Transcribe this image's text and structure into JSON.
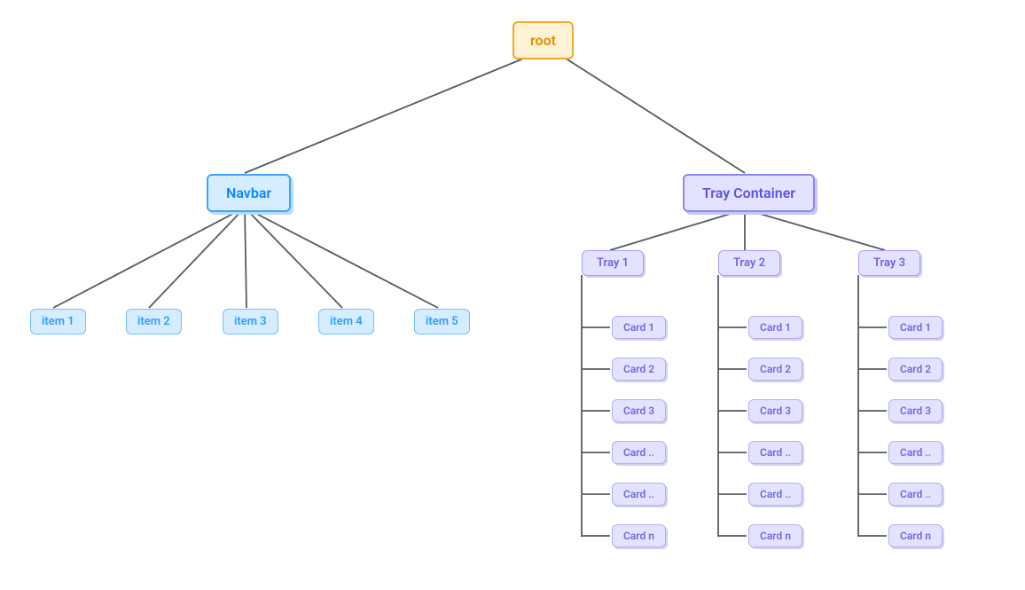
{
  "root": {
    "label": "root"
  },
  "navbar": {
    "label": "Navbar",
    "items": [
      {
        "label": "item 1"
      },
      {
        "label": "item 2"
      },
      {
        "label": "item 3"
      },
      {
        "label": "item 4"
      },
      {
        "label": "item 5"
      }
    ]
  },
  "trayContainer": {
    "label": "Tray Container",
    "trays": [
      {
        "label": "Tray 1",
        "cards": [
          {
            "label": "Card 1"
          },
          {
            "label": "Card 2"
          },
          {
            "label": "Card 3"
          },
          {
            "label": "Card .."
          },
          {
            "label": "Card .."
          },
          {
            "label": "Card n"
          }
        ]
      },
      {
        "label": "Tray 2",
        "cards": [
          {
            "label": "Card 1"
          },
          {
            "label": "Card 2"
          },
          {
            "label": "Card 3"
          },
          {
            "label": "Card .."
          },
          {
            "label": "Card .."
          },
          {
            "label": "Card n"
          }
        ]
      },
      {
        "label": "Tray 3",
        "cards": [
          {
            "label": "Card 1"
          },
          {
            "label": "Card 2"
          },
          {
            "label": "Card 3"
          },
          {
            "label": "Card .."
          },
          {
            "label": "Card .."
          },
          {
            "label": "Card n"
          }
        ]
      }
    ]
  },
  "colors": {
    "edge": "#555c66",
    "rootBorder": "#f5a623",
    "navBorder": "#3da5ff",
    "trayBorder": "#8b86f7"
  }
}
